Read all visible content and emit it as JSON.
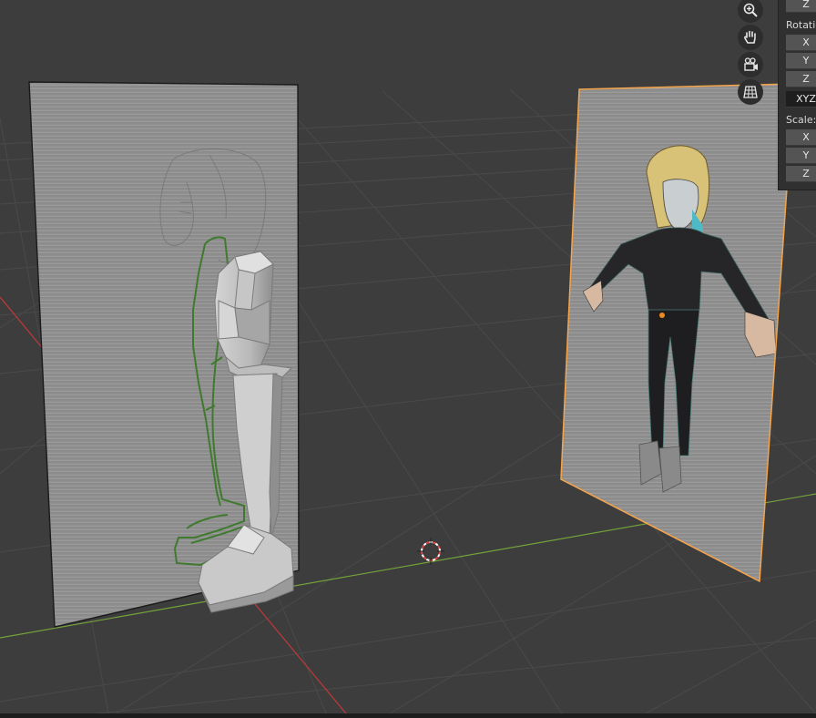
{
  "viewport": {
    "background_color": "#3d3d3d",
    "grid_line_color": "#4a4a4a",
    "x_axis_color": "#c0393a",
    "y_axis_color": "#74a23a",
    "selection_outline_color": "#f5a44a"
  },
  "nav_gizmo": {
    "buttons": [
      {
        "icon": "zoom-icon"
      },
      {
        "icon": "pan-hand-icon"
      },
      {
        "icon": "camera-view-icon"
      },
      {
        "icon": "orthographic-grid-icon"
      }
    ]
  },
  "n_panel": {
    "location_z": "Z",
    "rotation_label": "Rotatio",
    "rotation_x": "X",
    "rotation_y": "Y",
    "rotation_z": "Z",
    "rotation_mode": "XYZ",
    "scale_label": "Scale:",
    "scale_x": "X",
    "scale_y": "Y",
    "scale_z": "Z"
  },
  "objects": [
    {
      "name": "side-reference-image",
      "selected": false
    },
    {
      "name": "low-poly-leg-mesh",
      "selected": false
    },
    {
      "name": "front-reference-image",
      "selected": true
    },
    {
      "name": "3d-cursor",
      "selected": false
    }
  ]
}
